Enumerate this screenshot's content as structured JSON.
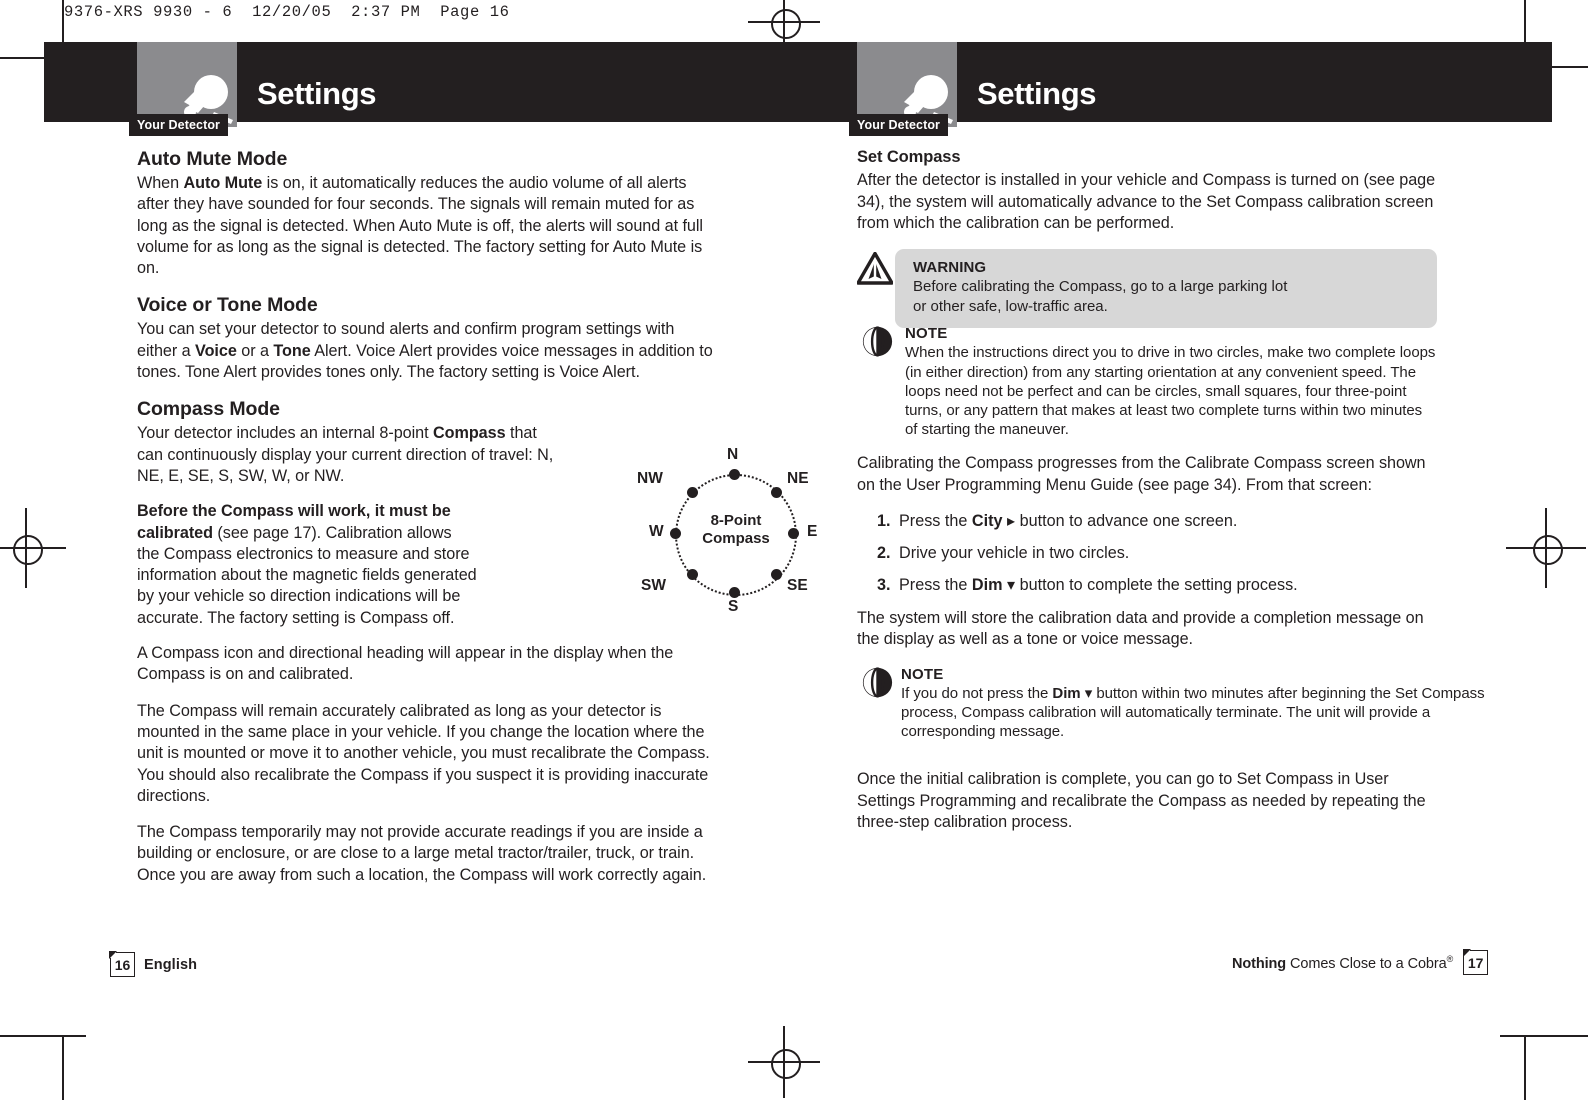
{
  "slug": "9376-XRS 9930 - 6  12/20/05  2:37 PM  Page 16",
  "colors": {
    "dark": "#231f20",
    "thumb_gray": "#8b8b8e",
    "callout_gray": "#d7d7d7"
  },
  "header_left": {
    "title": "Settings",
    "badge": "Your Detector",
    "icon": "detector-icon"
  },
  "header_right": {
    "title": "Settings",
    "badge": "Your Detector",
    "icon": "detector-icon"
  },
  "left_page": {
    "sections": [
      {
        "heading": "Auto Mute Mode",
        "paragraphs": [
          "When <b>Auto Mute</b> is on, it automatically reduces the audio volume of all alerts after they have sounded for four seconds. The signals will remain muted for as long as the signal is detected. When Auto Mute is off, the alerts will sound at full volume for as long as the signal is detected. The factory setting for Auto Mute is on."
        ]
      },
      {
        "heading": "Voice or Tone Mode",
        "paragraphs": [
          "You can set your detector to sound alerts and confirm program settings with either a <b>Voice</b> or a <b>Tone</b> Alert. Voice Alert provides voice messages in addition to tones. Tone Alert provides tones only. The factory setting is Voice Alert."
        ]
      },
      {
        "heading": "Compass Mode",
        "paragraphs": [
          "Your detector includes an internal 8-point <b>Compass</b> that can continuously display your current direction of travel: N, NE, E, SE, S, SW, W, or NW.",
          "<b>Before the Compass will work, it must be calibrated</b> (see page 17). Calibration allows the Compass electronics to measure and store information about the magnetic fields generated by your vehicle so direction indications will be accurate. The factory setting is Compass off.",
          "A Compass icon and directional heading will appear in the display when the Compass is on and calibrated.",
          "The Compass will remain accurately calibrated as long as your detector is mounted in the same place in your vehicle. If you change the location where the unit is mounted or move it to another vehicle, you must recalibrate the Compass. You should also recalibrate the Compass if you suspect it is providing inaccurate directions.",
          "The Compass temporarily may not provide accurate readings if you are inside a building or enclosure, or are close to a large metal tractor/trailer, truck, or train. Once you are away from such a location, the Compass will work correctly again."
        ]
      }
    ],
    "compass_figure": {
      "center_line1": "8-Point",
      "center_line2": "Compass",
      "points": [
        "N",
        "NE",
        "E",
        "SE",
        "S",
        "SW",
        "W",
        "NW"
      ]
    },
    "footer": {
      "page_number": "16",
      "language": "English"
    }
  },
  "right_page": {
    "heading": "Set Compass",
    "intro": "After the detector is installed in your vehicle and Compass is turned on (see page 34), the system will automatically advance to the Set Compass calibration screen from which the calibration can be performed.",
    "warning": {
      "icon": "warning-triangle-icon",
      "title": "WARNING",
      "text": "Before calibrating the Compass, go to a large parking lot<br>or other safe, low-traffic area."
    },
    "note_1": {
      "icon": "note-icon",
      "title": "NOTE",
      "text": "When the instructions direct you to drive in two circles, make two complete loops (in either direction) from any starting orientation at any convenient speed. The loops need not be perfect and can be circles, small squares, four three-point turns, or any pattern that makes at least two complete turns within two minutes of starting the maneuver."
    },
    "calibrating_intro": "Calibrating the Compass progresses from the Calibrate Compass screen shown on the User Programming Menu Guide (see page 34). From that screen:",
    "steps": [
      {
        "n": "1.",
        "text": "Press the <b>City</b> <span class=\"glyph\">&#9656;</span> button to advance one screen."
      },
      {
        "n": "2.",
        "text": "Drive your vehicle in two circles."
      },
      {
        "n": "3.",
        "text": "Press the <b>Dim</b> <span class=\"glyph\">&#9662;</span> button to complete the setting process."
      }
    ],
    "after_steps": "The system will store the calibration data and provide a completion message on the display as well as a tone or voice message.",
    "note_2": {
      "icon": "note-icon",
      "title": "NOTE",
      "text": "If you do not press the <b>Dim</b> <span class=\"glyph\">&#9662;</span> button within two minutes after beginning the Set Compass process, Compass calibration will automatically terminate. The unit will provide a corresponding message."
    },
    "closing": "Once the initial calibration is complete, you can go to Set Compass in User Settings Programming and recalibrate the Compass as needed by repeating the three-step calibration process.",
    "footer": {
      "page_number": "17",
      "tagline_bold": "Nothing",
      "tagline_rest": "Comes Close to a Cobra",
      "tagline_mark": "®"
    }
  }
}
